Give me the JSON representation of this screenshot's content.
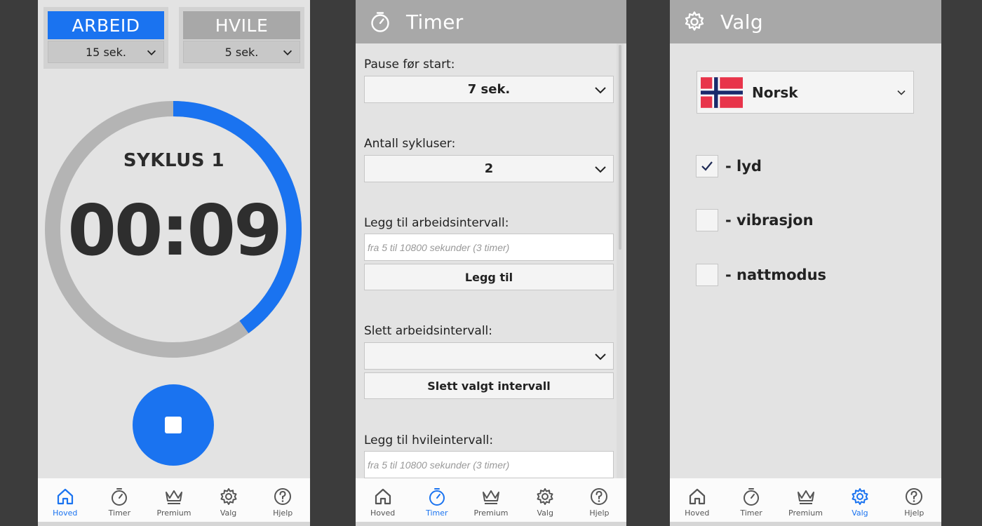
{
  "colors": {
    "accent": "#1a73f0",
    "header": "#a8a8a8",
    "ring_track": "#b4b4b4",
    "panel": "#e3e3e3"
  },
  "main": {
    "work_mode": {
      "label": "ARBEID",
      "value": "15 sek."
    },
    "rest_mode": {
      "label": "HVILE",
      "value": "5 sek."
    },
    "cycle_label": "SYKLUS 1",
    "time": "00:09",
    "progress_fraction": 0.4,
    "stop_icon": "stop-icon"
  },
  "timer": {
    "title": "Timer",
    "pause_label": "Pause før start:",
    "pause_value": "7 sek.",
    "cycles_label": "Antall sykluser:",
    "cycles_value": "2",
    "add_work_label": "Legg til arbeidsintervall:",
    "add_work_placeholder": "fra 5 til 10800 sekunder (3 timer)",
    "add_button": "Legg til",
    "delete_work_label": "Slett arbeidsintervall:",
    "delete_work_value": "",
    "delete_button": "Slett valgt intervall",
    "add_rest_label": "Legg til hvileintervall:",
    "add_rest_placeholder": "fra 5 til 10800 sekunder (3 timer)"
  },
  "settings": {
    "title": "Valg",
    "language": "Norsk",
    "options": [
      {
        "label": "- lyd",
        "checked": true
      },
      {
        "label": "- vibrasjon",
        "checked": false
      },
      {
        "label": "- nattmodus",
        "checked": false
      }
    ]
  },
  "nav": {
    "items": [
      {
        "label": "Hoved",
        "icon": "home-icon"
      },
      {
        "label": "Timer",
        "icon": "stopwatch-icon"
      },
      {
        "label": "Premium",
        "icon": "crown-icon"
      },
      {
        "label": "Valg",
        "icon": "gear-icon"
      },
      {
        "label": "Hjelp",
        "icon": "help-icon"
      }
    ]
  }
}
